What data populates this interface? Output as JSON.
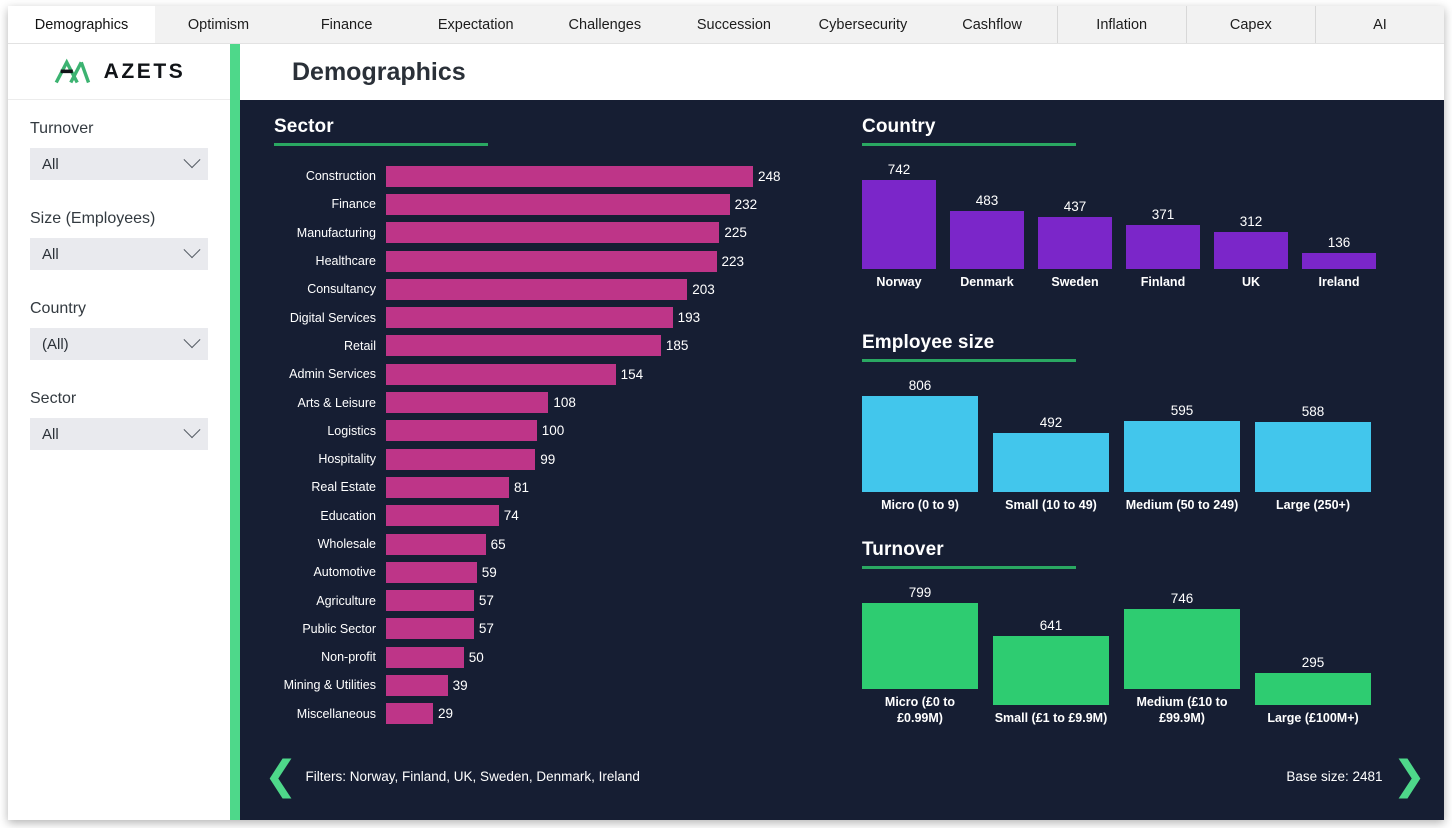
{
  "tabs": [
    {
      "label": "Demographics",
      "active": true,
      "width": 148,
      "divider": false
    },
    {
      "label": "Optimism",
      "active": false,
      "width": 128,
      "divider": false
    },
    {
      "label": "Finance",
      "active": false,
      "width": 130,
      "divider": false
    },
    {
      "label": "Expectation",
      "active": false,
      "width": 130,
      "divider": false
    },
    {
      "label": "Challenges",
      "active": false,
      "width": 130,
      "divider": false
    },
    {
      "label": "Succession",
      "active": false,
      "width": 130,
      "divider": false
    },
    {
      "label": "Cybersecurity",
      "active": false,
      "width": 130,
      "divider": false
    },
    {
      "label": "Cashflow",
      "active": false,
      "width": 130,
      "divider": false
    },
    {
      "label": "Inflation",
      "active": false,
      "width": 130,
      "divider": true
    },
    {
      "label": "Capex",
      "active": false,
      "width": 130,
      "divider": true
    },
    {
      "label": "AI",
      "active": false,
      "width": 130,
      "divider": true
    }
  ],
  "brand": {
    "name": "AZETS",
    "green": "#3cb371",
    "logo_icon": "azets-logo-icon"
  },
  "sidebar": {
    "filters": [
      {
        "label": "Turnover",
        "value": "All",
        "icon": "chevron-down-icon"
      },
      {
        "label": "Size (Employees)",
        "value": "All",
        "icon": "chevron-down-icon"
      },
      {
        "label": "Country",
        "value": "(All)",
        "icon": "chevron-down-icon"
      },
      {
        "label": "Sector",
        "value": "All",
        "icon": "chevron-down-icon"
      }
    ]
  },
  "header": {
    "title": "Demographics"
  },
  "colors": {
    "canvas_bg": "#161e33",
    "accent_green": "#4ed88a",
    "underline_green": "#2aa862",
    "sector_pink": "#be3588",
    "country_purple": "#7b26c9",
    "employee_blue": "#42c6ec",
    "turnover_green": "#2ecc71"
  },
  "footer": {
    "filters_text": "Filters: Norway, Finland, UK, Sweden, Denmark, Ireland",
    "base_size_text": "Base size: 2481",
    "prev_icon": "chevron-left-icon",
    "next_icon": "chevron-right-icon"
  },
  "chart_data": [
    {
      "type": "bar",
      "orientation": "horizontal",
      "title": "Sector",
      "xlabel": "",
      "ylabel": "",
      "categories": [
        "Construction",
        "Finance",
        "Manufacturing",
        "Healthcare",
        "Consultancy",
        "Digital Services",
        "Retail",
        "Admin Services",
        "Arts & Leisure",
        "Logistics",
        "Hospitality",
        "Real Estate",
        "Education",
        "Wholesale",
        "Automotive",
        "Agriculture",
        "Public Sector",
        "Non-profit",
        "Mining & Utilities",
        "Miscellaneous"
      ],
      "values": [
        248,
        232,
        225,
        223,
        203,
        193,
        185,
        154,
        108,
        100,
        99,
        81,
        74,
        65,
        59,
        57,
        57,
        50,
        39,
        29
      ],
      "color": "#be3588",
      "grid": false,
      "legend": "none",
      "xlim": [
        0,
        248
      ]
    },
    {
      "type": "bar",
      "orientation": "vertical",
      "title": "Country",
      "xlabel": "",
      "ylabel": "",
      "categories": [
        "Norway",
        "Denmark",
        "Sweden",
        "Finland",
        "UK",
        "Ireland"
      ],
      "values": [
        742,
        483,
        437,
        371,
        312,
        136
      ],
      "color": "#7b26c9",
      "grid": false,
      "legend": "none",
      "ylim": [
        0,
        742
      ]
    },
    {
      "type": "bar",
      "orientation": "vertical",
      "title": "Employee size",
      "xlabel": "",
      "ylabel": "",
      "categories": [
        "Micro (0 to 9)",
        "Small (10 to 49)",
        "Medium (50 to 249)",
        "Large (250+)"
      ],
      "values": [
        806,
        492,
        595,
        588
      ],
      "color": "#42c6ec",
      "grid": false,
      "legend": "none",
      "ylim": [
        0,
        806
      ]
    },
    {
      "type": "bar",
      "orientation": "vertical",
      "title": "Turnover",
      "xlabel": "",
      "ylabel": "",
      "categories": [
        "Micro (£0 to £0.99M)",
        "Small (£1 to £9.9M)",
        "Medium (£10 to £99.9M)",
        "Large (£100M+)"
      ],
      "values": [
        799,
        641,
        746,
        295
      ],
      "color": "#2ecc71",
      "grid": false,
      "legend": "none",
      "ylim": [
        0,
        799
      ]
    }
  ]
}
